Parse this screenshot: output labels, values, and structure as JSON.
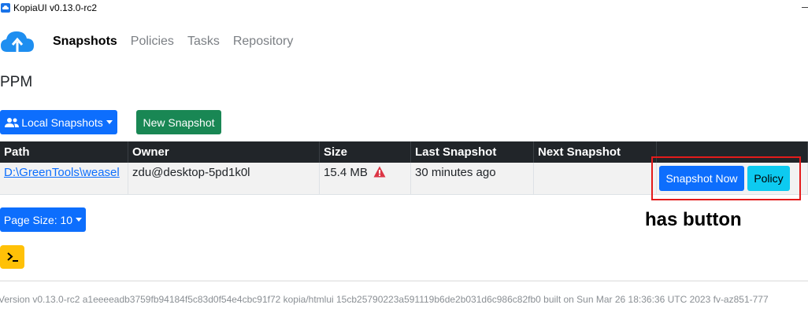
{
  "window": {
    "title": "KopiaUI v0.13.0-rc2"
  },
  "nav": {
    "links": [
      {
        "label": "Snapshots",
        "active": true
      },
      {
        "label": "Policies",
        "active": false
      },
      {
        "label": "Tasks",
        "active": false
      },
      {
        "label": "Repository",
        "active": false
      }
    ]
  },
  "page": {
    "title": "PPM"
  },
  "toolbar": {
    "local_snapshots_label": "Local Snapshots",
    "new_snapshot_label": "New Snapshot"
  },
  "table": {
    "headers": [
      "Path",
      "Owner",
      "Size",
      "Last Snapshot",
      "Next Snapshot",
      ""
    ],
    "rows": [
      {
        "path": "D:\\GreenTools\\weasel",
        "owner": "zdu@desktop-5pd1k0l",
        "size": "15.4 MB",
        "last_snapshot": "30 minutes ago",
        "next_snapshot": "",
        "snapshot_now_label": "Snapshot Now",
        "policy_label": "Policy"
      }
    ]
  },
  "annotation": {
    "text": "has button"
  },
  "pagination": {
    "page_size_label": "Page Size: 10"
  },
  "footer": {
    "version_text": "Version v0.13.0-rc2 a1eeeeadb3759fb94184f5c83d0f54e4cbc91f72 kopia/htmlui 15cb25790223a591119b6de2b031d6c986c82fb0 built on Sun Mar 26 18:36:36 UTC 2023 fv-az851-777"
  },
  "colors": {
    "primary": "#0d6efd",
    "success": "#198754",
    "info": "#0dcaf0",
    "warning": "#ffc107",
    "danger": "#dc3545",
    "header_dark": "#212529",
    "annotation_red": "#e41b1b"
  }
}
